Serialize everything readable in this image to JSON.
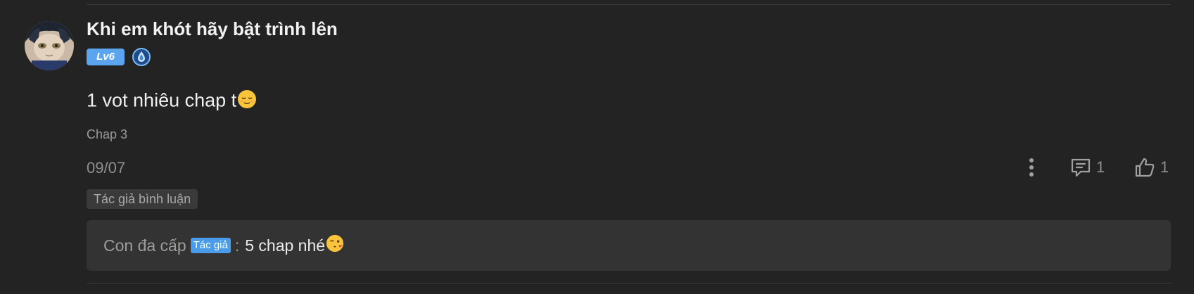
{
  "comment": {
    "username": "Khi em khót hãy bật trình lên",
    "level": "Lv6",
    "text": "1 vot nhiêu chap t",
    "text_emoji": "relieved-face",
    "chapter": "Chap 3",
    "date": "09/07",
    "author_tag": "Tác giả bình luận",
    "reply_count": "1",
    "like_count": "1"
  },
  "reply": {
    "author": "Con đa cấp",
    "author_badge": "Tác giả",
    "separator": ":",
    "text": "5 chap nhé",
    "text_emoji": "face-blowing-kiss"
  },
  "colors": {
    "background": "#232323",
    "level_badge": "#5aa5ee",
    "author_badge": "#4a9be8",
    "reply_box": "#333333"
  },
  "icons": {
    "rank": "shield-drop-icon",
    "more": "vertical-dots-icon",
    "reply": "comment-icon",
    "like": "thumbs-up-icon"
  }
}
